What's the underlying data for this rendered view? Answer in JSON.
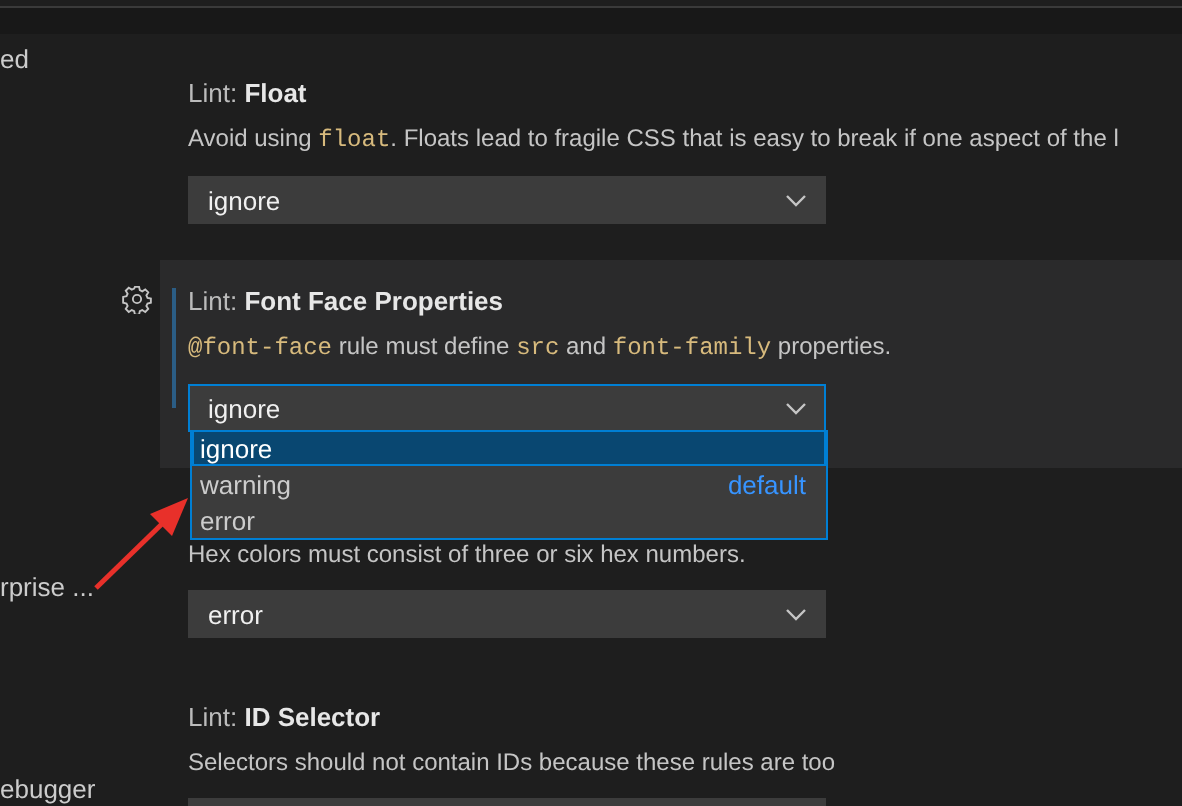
{
  "sidebar": {
    "items": [
      "ed",
      "rprise ...",
      "ebugger"
    ]
  },
  "settings": [
    {
      "category": "Lint:",
      "name": "Float",
      "description": [
        {
          "text": "Avoid using "
        },
        {
          "text": "float",
          "kind": "code"
        },
        {
          "text": ". Floats lead to fragile CSS that is easy to break if one aspect of the l"
        }
      ],
      "value": "ignore",
      "focused": false
    },
    {
      "category": "Lint:",
      "name": "Font Face Properties",
      "description": [
        {
          "text": "@font-face",
          "kind": "code"
        },
        {
          "text": " rule must define "
        },
        {
          "text": "src",
          "kind": "code"
        },
        {
          "text": " and "
        },
        {
          "text": "font-family",
          "kind": "code"
        },
        {
          "text": " properties."
        }
      ],
      "value": "ignore",
      "focused": true,
      "dropdown": {
        "options": [
          {
            "label": "ignore",
            "selected": true
          },
          {
            "label": "warning",
            "selected": false,
            "badge": "default"
          },
          {
            "label": "error",
            "selected": false
          }
        ]
      }
    },
    {
      "description": [
        {
          "text": "Hex colors must consist of three or six hex numbers."
        }
      ],
      "value": "error",
      "focused": false
    },
    {
      "category": "Lint:",
      "name": "ID Selector",
      "description": [
        {
          "text": "Selectors should not contain IDs because these rules are too"
        }
      ],
      "focused": false
    }
  ]
}
